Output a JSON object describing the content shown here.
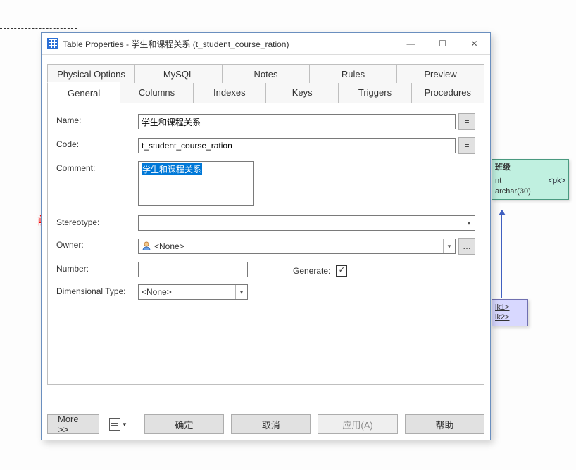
{
  "window": {
    "title": "Table Properties - 学生和课程关系 (t_student_course_ration)"
  },
  "tabs_top": [
    "Physical Options",
    "MySQL",
    "Notes",
    "Rules",
    "Preview"
  ],
  "tabs_bottom": [
    "General",
    "Columns",
    "Indexes",
    "Keys",
    "Triggers",
    "Procedures"
  ],
  "active_tab": "General",
  "form": {
    "name_label": "Name:",
    "name_value": "学生和课程关系",
    "code_label": "Code:",
    "code_value": "t_student_course_ration",
    "comment_label": "Comment:",
    "comment_value": "学生和课程关系",
    "stereotype_label": "Stereotype:",
    "stereotype_value": "",
    "owner_label": "Owner:",
    "owner_value": "<None>",
    "number_label": "Number:",
    "number_value": "",
    "generate_label": "Generate:",
    "generate_checked": true,
    "dim_label": "Dimensional Type:",
    "dim_value": "<None>",
    "eq": "="
  },
  "buttons": {
    "more": "More >>",
    "ok": "确定",
    "cancel": "取消",
    "apply": "应用(A)",
    "help": "帮助"
  },
  "annotation": "前缀是有的",
  "bg_entities": {
    "e1_title": "班级",
    "e1_col": "nt",
    "e1_type": "archar(30)",
    "e1_pk": "<pk>",
    "e2_k1": "ik1>",
    "e2_k2": "ik2>"
  }
}
